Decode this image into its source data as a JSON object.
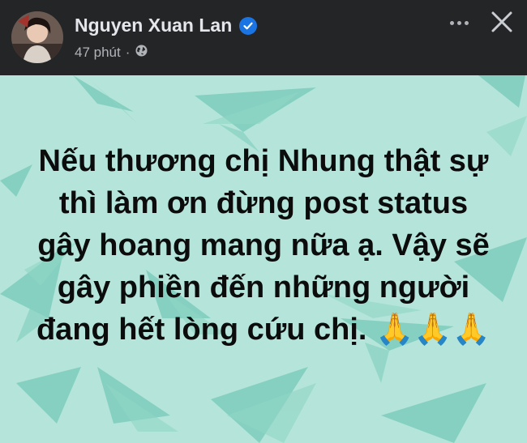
{
  "post": {
    "author": "Nguyen Xuan Lan",
    "time": "47 phút",
    "separator": "·",
    "icons": [
      "verified-badge-icon",
      "globe-icon",
      "more-options-icon",
      "close-icon"
    ],
    "message": "Nếu thương chị Nhung thật sự thì làm ơn đừng post status gây hoang mang nữa ạ. Vậy sẽ gây phiền đến những người đang hết lòng cứu chị.",
    "emojis": "🙏🙏🙏",
    "background_color": "#b5e5da",
    "accent_color": "#1b74e4"
  }
}
